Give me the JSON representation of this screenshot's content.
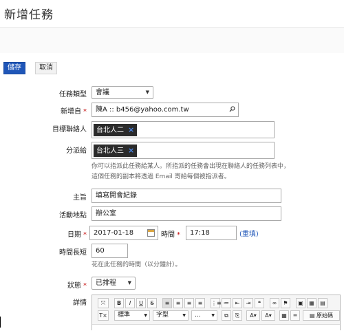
{
  "page": {
    "title": "新增任務"
  },
  "actions": {
    "save_label": "儲存",
    "cancel_label": "取消"
  },
  "form": {
    "task_type": {
      "label": "任務類型",
      "value": "會議"
    },
    "created_by": {
      "label": "新增自",
      "value": "陳A :: b456@yahoo.com.tw"
    },
    "target_contacts": {
      "label": "目標聯絡人",
      "tags": [
        "台北人二"
      ]
    },
    "assign_to": {
      "label": "分派給",
      "tags": [
        "台北人三"
      ],
      "help_lines": [
        "你可以指派此任務給某人。所指派的任務會出現在聯絡人的任務列表中，",
        "這個任務的副本將透過 Email 寄給每個被指派者。"
      ]
    },
    "subject": {
      "label": "主旨",
      "value": "填寫開會紀錄"
    },
    "location": {
      "label": "活動地點",
      "value": "辦公室"
    },
    "date": {
      "label": "日期",
      "value": "2017-01-18"
    },
    "time": {
      "label": "時間",
      "value": "17:18",
      "reset_link": "(重填)"
    },
    "duration": {
      "label": "時間長短",
      "value": "60",
      "help": "花在此任務的時間（以分鐘計）。"
    },
    "status": {
      "label": "狀態",
      "value": "已排程"
    },
    "details": {
      "label": "詳情"
    }
  },
  "editor": {
    "row1": [
      "⤧",
      "B",
      "I",
      "U",
      "S",
      "≡",
      "≡",
      "≡",
      "≡",
      "⋮≡",
      "≔",
      "⇤",
      "⇥",
      "❝",
      "∞",
      "⚑",
      "▣",
      "▦",
      "▤"
    ],
    "row2": {
      "clear": "T×",
      "format_label": "標準",
      "font_label": "字型",
      "size_label": "...",
      "source_label": "原始碼"
    }
  },
  "colors": {
    "accent": "#1f56b8",
    "required": "#c40000"
  }
}
